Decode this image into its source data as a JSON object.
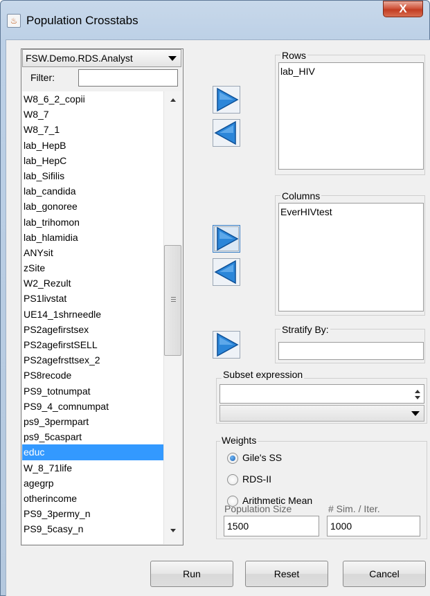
{
  "window": {
    "title": "Population Crosstabs",
    "close_glyph": "X",
    "app_icon": "java-cup-icon"
  },
  "left_panel": {
    "dataset": "FSW.Demo.RDS.Analyst",
    "filter_label": "Filter:",
    "filter_value": "",
    "variables": [
      "W8_6_2_copii",
      "W8_7",
      "W8_7_1",
      "lab_HepB",
      "lab_HepC",
      "lab_Sifilis",
      "lab_candida",
      "lab_gonoree",
      "lab_trihomon",
      "lab_hlamidia",
      "ANYsit",
      "zSite",
      "W2_Rezult",
      "PS1livstat",
      "UE14_1shrneedle",
      "PS2agefirstsex",
      "PS2agefirstSELL",
      "PS2agefrsttsex_2",
      "PS8recode",
      "PS9_totnumpat",
      "PS9_4_comnumpat",
      "ps9_3permpart",
      "ps9_5caspart",
      "educ",
      "W_8_71life",
      "agegrp",
      "otherincome",
      "PS9_3permy_n",
      "PS9_5casy_n"
    ],
    "selected_variable": "educ"
  },
  "rows": {
    "label": "Rows",
    "items": [
      "lab_HIV"
    ]
  },
  "columns": {
    "label": "Columns",
    "items": [
      "EverHIVtest"
    ]
  },
  "stratify": {
    "label": "Stratify By:",
    "value": ""
  },
  "subset": {
    "label": "Subset expression",
    "value": "",
    "combo_value": ""
  },
  "weights": {
    "label": "Weights",
    "options": [
      "Gile's SS",
      "RDS-II",
      "Arithmetic Mean"
    ],
    "selected": "Gile's SS",
    "population_size_label": "Population Size",
    "population_size": "1500",
    "sim_iter_label": "# Sim. / Iter.",
    "sim_iter": "1000"
  },
  "buttons": {
    "run": "Run",
    "reset": "Reset",
    "cancel": "Cancel"
  },
  "colors": {
    "selection": "#3399ff",
    "arrow_blue": "#1f7fd8",
    "close_red": "#c84a30"
  }
}
